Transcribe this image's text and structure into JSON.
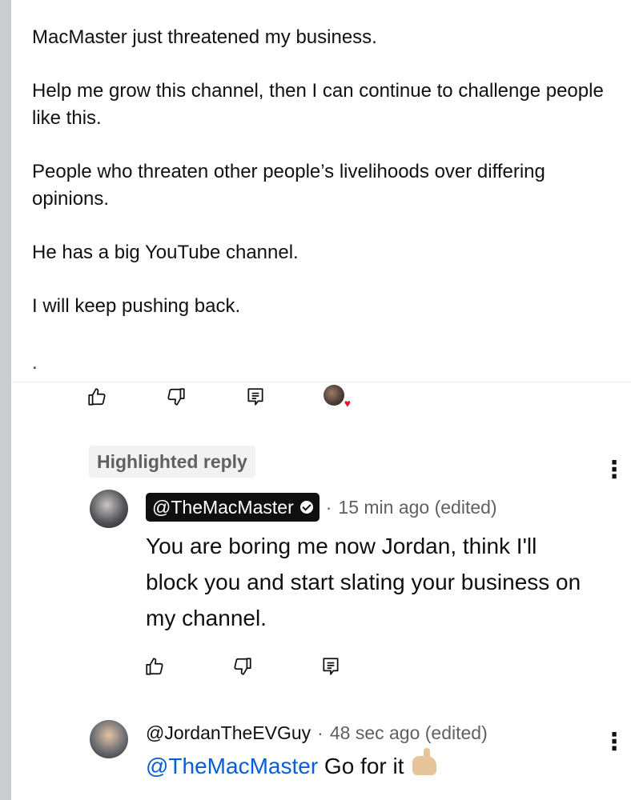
{
  "post": {
    "paragraphs": [
      "MacMaster just threatened my business.",
      "Help me grow this channel, then I can continue to challenge people like this.",
      "People who threaten other people’s livelihoods over differing opinions.",
      "He has a big YouTube channel.",
      "I will keep pushing back."
    ],
    "trailing_dot": "."
  },
  "highlighted_label": "Highlighted reply",
  "reply1": {
    "handle": "@TheMacMaster",
    "separator": "·",
    "time": "15 min ago (edited)",
    "text": "You are boring me now Jordan, think I'll block you and start slating your business on my channel."
  },
  "reply2": {
    "handle": "@JordanTheEVGuy",
    "separator": "·",
    "time": "48 sec ago (edited)",
    "mention": "@TheMacMaster",
    "text": " Go for it"
  },
  "kebab_glyph": "⋮",
  "heart_glyph": "♥",
  "icons": {
    "like": "thumbs-up-icon",
    "dislike": "thumbs-down-icon",
    "reply": "reply-comment-icon",
    "creator_heart": "creator-heart-icon",
    "more": "more-vertical-icon",
    "verified": "verified-check-icon"
  },
  "colors": {
    "text": "#0f0f0f",
    "meta": "#606060",
    "mention": "#065fd4",
    "heart": "#e0182d",
    "left_bar": "#c9ccd1"
  }
}
